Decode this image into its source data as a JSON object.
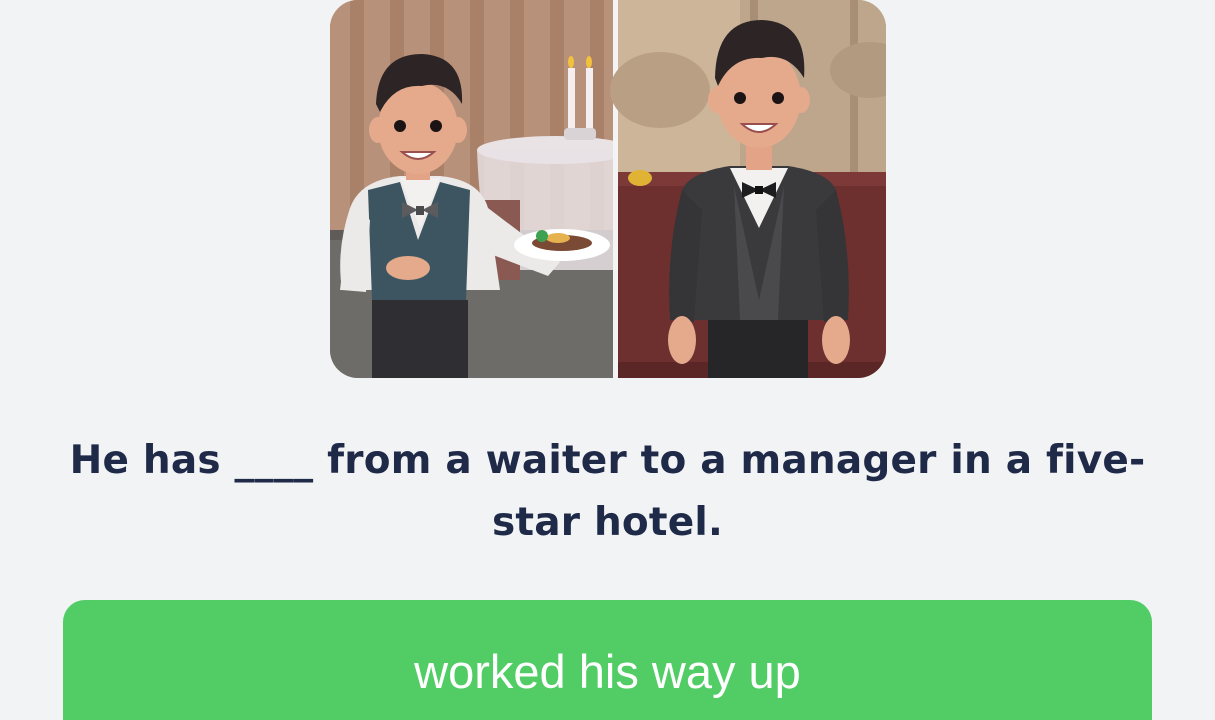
{
  "question": {
    "text": "He has ____ from a waiter to a manager in a five-star hotel."
  },
  "answer_option": {
    "label": "worked his way up",
    "color": "#52cd66"
  },
  "illustration": {
    "left_scene": "waiter-serving-plate",
    "right_scene": "manager-in-suit"
  },
  "colors": {
    "background": "#f2f3f5",
    "text": "#1f2a48"
  }
}
